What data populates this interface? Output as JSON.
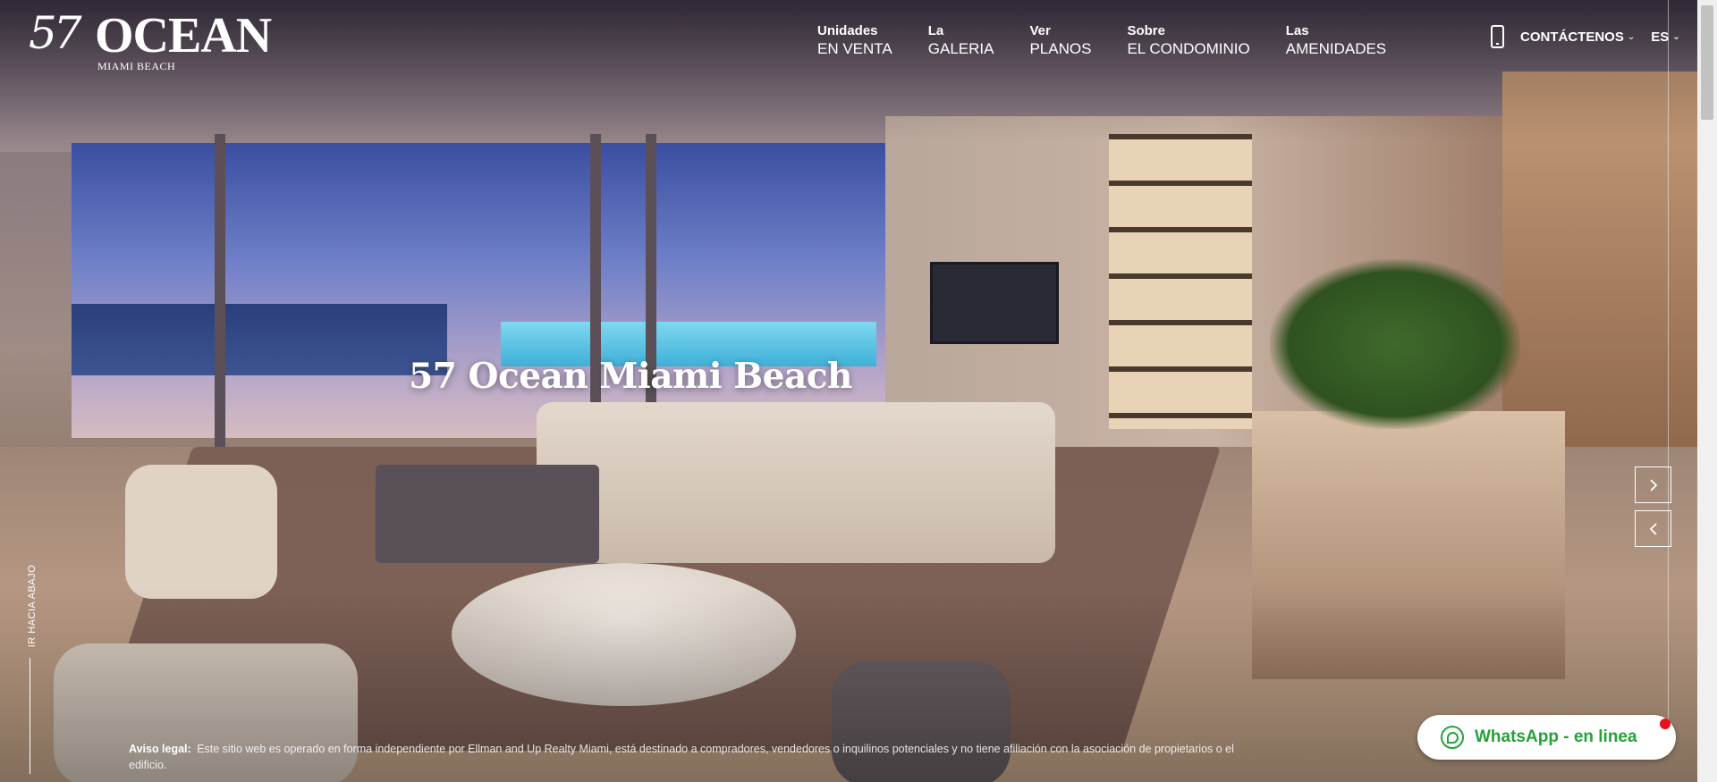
{
  "logo": {
    "number": "57",
    "name": "OCEAN",
    "subtitle": "MIAMI BEACH"
  },
  "nav": [
    {
      "small": "Unidades",
      "big": "EN VENTA"
    },
    {
      "small": "La",
      "big": "GALERIA"
    },
    {
      "small": "Ver",
      "big": "PLANOS"
    },
    {
      "small": "Sobre",
      "big": "EL CONDOMINIO"
    },
    {
      "small": "Las",
      "big": "AMENIDADES"
    }
  ],
  "contact": {
    "label": "CONTÁCTENOS",
    "icon": "phone-icon"
  },
  "language": {
    "selected": "ES"
  },
  "hero": {
    "title": "57 Ocean Miami Beach"
  },
  "scroll_down": {
    "label": "IR HACIA ABAJO"
  },
  "legal": {
    "label": "Aviso legal:",
    "text": "Este sitio web es operado en forma independiente por Ellman and Up Realty Miami, está destinado a compradores, vendedores o inquilinos potenciales y no tiene afiliación con la asociación de propietarios o el edificio."
  },
  "whatsapp": {
    "label": "WhatsApp - en linea",
    "color": "#25a23a",
    "dot_color": "#e8101a"
  },
  "slider": {
    "next_icon": "chevron-right-icon",
    "prev_icon": "chevron-left-icon"
  }
}
